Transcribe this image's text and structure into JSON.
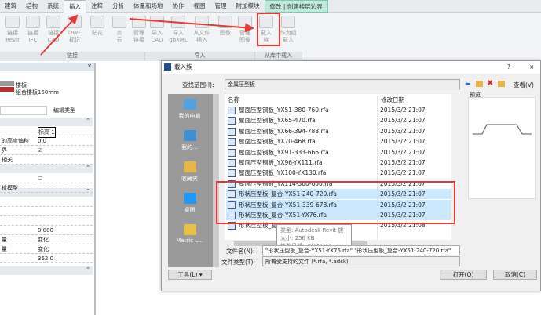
{
  "ribbon": {
    "tabs": [
      "建筑",
      "结构",
      "系统",
      "插入",
      "注释",
      "分析",
      "体量和场地",
      "协作",
      "视图",
      "管理",
      "附加模块",
      "修改 | 创建楼层边界"
    ],
    "active_tab": "插入",
    "buttons": [
      "链接\nRevit",
      "链接\nIFC",
      "链接\nCAD",
      "DWF\n标记",
      "贴花",
      "点\n云",
      "管理\n链接",
      "导入\nCAD",
      "导入\ngbXML",
      "从文件\n插入",
      "图像",
      "管理\n图像",
      "载入\n族",
      "作为组\n载入"
    ],
    "groups": [
      "链接",
      "导入",
      "从库中载入"
    ]
  },
  "properties": {
    "type_family": "楼板",
    "type_name": "组合楼板150mm",
    "edit_type": "编辑类型",
    "rows": [
      {
        "k": "",
        "v": "标高 1"
      },
      {
        "k": "的高度偏移",
        "v": "0.0"
      },
      {
        "k": "界",
        "v": "☑"
      },
      {
        "k": "相关",
        "v": ""
      },
      {
        "k": "",
        "v": "☐"
      },
      {
        "k": "析模型",
        "v": ""
      },
      {
        "k": "",
        "v": ""
      },
      {
        "k": "",
        "v": ""
      },
      {
        "k": "",
        "v": ""
      },
      {
        "k": "",
        "v": "0.000"
      },
      {
        "k": "量",
        "v": "变化"
      },
      {
        "k": "量",
        "v": "变化"
      },
      {
        "k": "",
        "v": "362.0"
      }
    ]
  },
  "dialog": {
    "title": "载入族",
    "help": "?",
    "close": "×",
    "look_in_label": "查找范围(I):",
    "look_in_value": "金属压型板",
    "view_label": "查看(V)",
    "preview_label": "预览",
    "places": [
      "我的电脑",
      "我的...",
      "收藏夹",
      "桌面",
      "Metric L..."
    ],
    "columns": [
      "名称",
      "修改日期"
    ],
    "files": [
      {
        "name": "屋面压型钢板_YX51-380-760.rfa",
        "date": "2015/3/2 21:07",
        "selected": false
      },
      {
        "name": "屋面压型钢板_YX65-470.rfa",
        "date": "2015/3/2 21:07",
        "selected": false
      },
      {
        "name": "屋面压型钢板_YX66-394-788.rfa",
        "date": "2015/3/2 21:07",
        "selected": false
      },
      {
        "name": "屋面压型钢板_YX70-468.rfa",
        "date": "2015/3/2 21:07",
        "selected": false
      },
      {
        "name": "屋面压型钢板_YX91-333-666.rfa",
        "date": "2015/3/2 21:07",
        "selected": false
      },
      {
        "name": "屋面压型钢板_YX96-YX111.rfa",
        "date": "2015/3/2 21:07",
        "selected": false
      },
      {
        "name": "屋面压型钢板_YX100-YX130.rfa",
        "date": "2015/3/2 21:07",
        "selected": false
      },
      {
        "name": "屋面压型钢板_YX114-300-600.rfa",
        "date": "2015/3/2 21:07",
        "selected": false
      },
      {
        "name": "形状压型板_复合-YX51-240-720.rfa",
        "date": "2015/3/2 21:07",
        "selected": true
      },
      {
        "name": "形状压型板_复合-YX51-339-678.rfa",
        "date": "2015/3/2 21:07",
        "selected": true
      },
      {
        "name": "形状压型板_复合-YX51-YX76.rfa",
        "date": "2015/3/2 21:07",
        "selected": true
      },
      {
        "name": "形状压型板_复合-...",
        "date": "2015/3/2 21:08",
        "selected": false
      }
    ],
    "tooltip": [
      "类型: Autodesk Revit 族",
      "大小: 256 KB",
      "修改日期: 2015/3/2 21:07"
    ],
    "filename_label": "文件名(N):",
    "filename_value": "\"形状压型板_复合-YX51-YX76.rfa\" \"形状压型板_复合-YX51-240-720.rfa\"",
    "filetype_label": "文件类型(T):",
    "filetype_value": "所有受支持的文件 (*.rfa, *.adsk)",
    "tools": "工具(L)",
    "open": "打开(O)",
    "cancel": "取消(C)"
  },
  "colors": {
    "annotation": "#e53935",
    "selection": "#cce8ff"
  }
}
